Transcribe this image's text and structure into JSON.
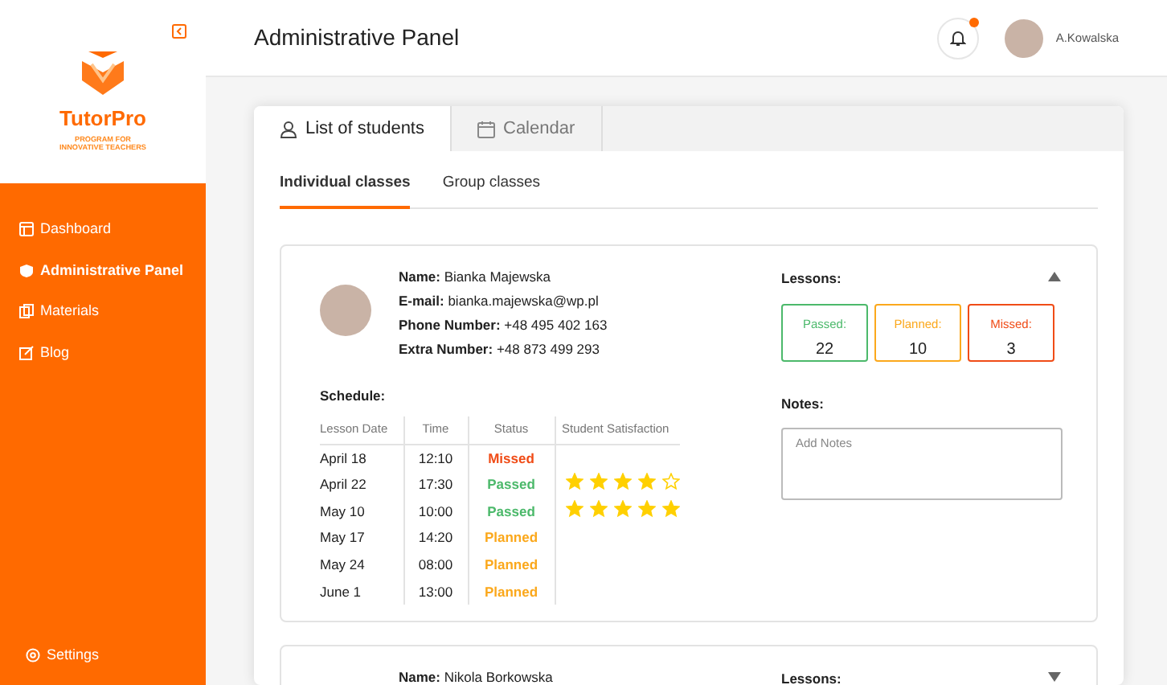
{
  "sidebar": {
    "brand": "TutorPro",
    "tagline": "PROGRAM FOR\nINNOVATIVE TEACHERS",
    "items": [
      {
        "label": "Dashboard",
        "selected": false
      },
      {
        "label": "Administrative Panel",
        "selected": true
      },
      {
        "label": "Materials",
        "selected": false
      },
      {
        "label": "Blog",
        "selected": false
      }
    ],
    "settings": "Settings"
  },
  "header": {
    "title": "Administrative Panel",
    "has_notification": true,
    "user": "A.Kowalska"
  },
  "tabs": [
    {
      "label": "List of students",
      "selected": true
    },
    {
      "label": "Calendar",
      "selected": false
    }
  ],
  "subtabs": [
    {
      "label": "Individual classes",
      "selected": true
    },
    {
      "label": "Group classes",
      "selected": false
    }
  ],
  "students": [
    {
      "expanded": true,
      "fields": [
        {
          "label": "Name:",
          "value": "Bianka Majewska"
        },
        {
          "label": "E-mail:",
          "value": "bianka.majewska@wp.pl"
        },
        {
          "label": "Phone Number:",
          "value": "+48 495 402 163"
        },
        {
          "label": "Extra Number:",
          "value": "+48 873 499 293"
        }
      ],
      "lessons_label": "Lessons:",
      "lessons": [
        {
          "kind": "passed",
          "label": "Passed:",
          "count": "22"
        },
        {
          "kind": "planned",
          "label": "Planned:",
          "count": "10"
        },
        {
          "kind": "missed",
          "label": "Missed:",
          "count": "3"
        }
      ],
      "schedule_label": "Schedule:",
      "columns": [
        "Lesson Date",
        "Time",
        "Status",
        "Student Satisfaction"
      ],
      "rows": [
        {
          "date": "April 18",
          "time": "12:10",
          "status": "Missed",
          "kind": "missed"
        },
        {
          "date": "April 22",
          "time": "17:30",
          "status": "Passed",
          "kind": "passed",
          "stars": 4
        },
        {
          "date": "May 10",
          "time": "10:00",
          "status": "Passed",
          "kind": "passed",
          "stars": 5
        },
        {
          "date": "May 17",
          "time": "14:20",
          "status": "Planned",
          "kind": "planned"
        },
        {
          "date": "May 24",
          "time": "08:00",
          "status": "Planned",
          "kind": "planned"
        },
        {
          "date": "June 1",
          "time": "13:00",
          "status": "Planned",
          "kind": "planned"
        }
      ],
      "notes_label": "Notes:",
      "notes_placeholder": "Add Notes"
    },
    {
      "expanded": false,
      "fields": [
        {
          "label": "Name:",
          "value": "Nikola Borkowska"
        }
      ],
      "lessons_label": "Lessons:"
    }
  ]
}
